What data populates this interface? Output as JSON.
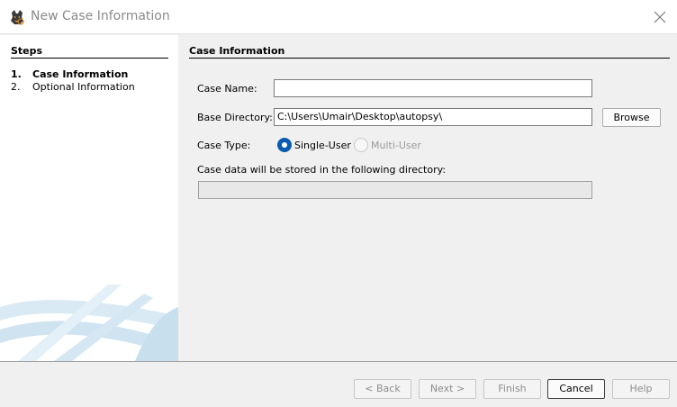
{
  "window": {
    "title": "New Case Information",
    "app_icon": "autopsy-dog-icon"
  },
  "steps": {
    "heading": "Steps",
    "items": [
      {
        "number": "1.",
        "label": "Case Information",
        "current": true
      },
      {
        "number": "2.",
        "label": "Optional Information",
        "current": false
      }
    ]
  },
  "panel": {
    "heading": "Case Information",
    "case_name_label": "Case Name:",
    "case_name_value": "",
    "base_directory_label": "Base Directory:",
    "base_directory_value": "C:\\Users\\Umair\\Desktop\\autopsy\\",
    "browse_label": "Browse",
    "case_type_label": "Case Type:",
    "case_type_options": [
      {
        "label": "Single-User",
        "selected": true,
        "enabled": true
      },
      {
        "label": "Multi-User",
        "selected": false,
        "enabled": false
      }
    ],
    "stored_label": "Case data will be stored in the following directory:",
    "stored_value": ""
  },
  "buttons": {
    "back": "< Back",
    "next": "Next >",
    "finish": "Finish",
    "cancel": "Cancel",
    "help": "Help"
  },
  "colors": {
    "radio_selected": "#0b5cb0",
    "decoration": "#cfe3f1"
  }
}
